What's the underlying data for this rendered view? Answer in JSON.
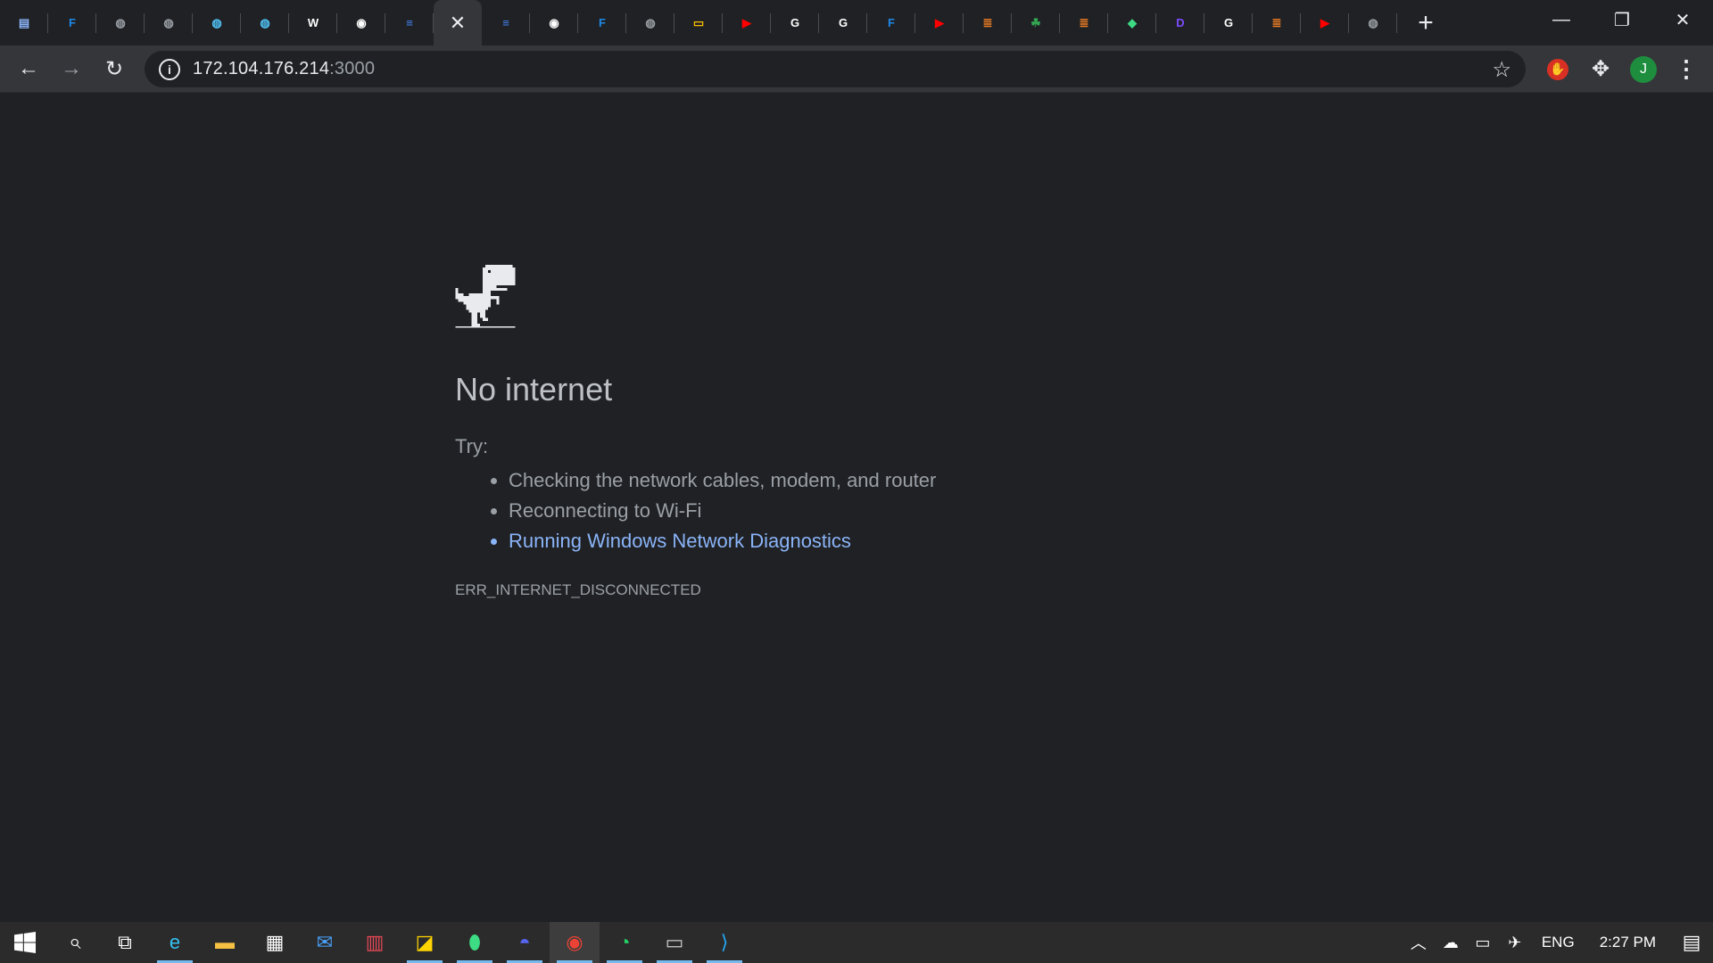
{
  "browser": {
    "tabs": [
      {
        "icon": "docs-file-icon",
        "color": "#8ab4f8",
        "glyph": "▤"
      },
      {
        "icon": "f-brand-icon",
        "color": "#1e88e5",
        "glyph": "F"
      },
      {
        "icon": "globe-icon",
        "color": "#9aa0a6",
        "glyph": "◍"
      },
      {
        "icon": "globe-icon",
        "color": "#9aa0a6",
        "glyph": "◍"
      },
      {
        "icon": "blue-globe-icon",
        "color": "#4fc3f7",
        "glyph": "◍"
      },
      {
        "icon": "blue-globe-icon",
        "color": "#4fc3f7",
        "glyph": "◍"
      },
      {
        "icon": "wikipedia-icon",
        "color": "#ffffff",
        "glyph": "W"
      },
      {
        "icon": "github-icon",
        "color": "#ffffff",
        "glyph": "◉"
      },
      {
        "icon": "google-docs-icon",
        "color": "#4285f4",
        "glyph": "≡"
      },
      {
        "icon": "close-icon",
        "color": "#e8eaed",
        "glyph": "✕",
        "active": true
      },
      {
        "icon": "google-docs-icon",
        "color": "#4285f4",
        "glyph": "≡"
      },
      {
        "icon": "github-icon",
        "color": "#ffffff",
        "glyph": "◉"
      },
      {
        "icon": "f-brand-icon",
        "color": "#1e88e5",
        "glyph": "F"
      },
      {
        "icon": "globe-icon",
        "color": "#9aa0a6",
        "glyph": "◍"
      },
      {
        "icon": "google-slides-icon",
        "color": "#fbbc04",
        "glyph": "▭"
      },
      {
        "icon": "youtube-icon",
        "color": "#ff0000",
        "glyph": "▶"
      },
      {
        "icon": "google-icon",
        "color": "#ffffff",
        "glyph": "G"
      },
      {
        "icon": "google-icon",
        "color": "#ffffff",
        "glyph": "G"
      },
      {
        "icon": "f-brand-icon",
        "color": "#1e88e5",
        "glyph": "F"
      },
      {
        "icon": "youtube-icon",
        "color": "#ff0000",
        "glyph": "▶"
      },
      {
        "icon": "stack-overflow-icon",
        "color": "#f48024",
        "glyph": "≣"
      },
      {
        "icon": "green-leaf-icon",
        "color": "#34a853",
        "glyph": "☘"
      },
      {
        "icon": "stack-overflow-icon",
        "color": "#f48024",
        "glyph": "≣"
      },
      {
        "icon": "android-icon",
        "color": "#3ddc84",
        "glyph": "◆"
      },
      {
        "icon": "purple-d-icon",
        "color": "#7c4dff",
        "glyph": "D"
      },
      {
        "icon": "google-icon",
        "color": "#ffffff",
        "glyph": "G"
      },
      {
        "icon": "stack-overflow-icon",
        "color": "#f48024",
        "glyph": "≣"
      },
      {
        "icon": "youtube-icon",
        "color": "#ff0000",
        "glyph": "▶"
      },
      {
        "icon": "globe-icon",
        "color": "#9aa0a6",
        "glyph": "◍"
      }
    ],
    "new_tab_glyph": "+",
    "window_controls": {
      "minimize": "—",
      "restore": "❐",
      "close": "✕"
    },
    "url_host": "172.104.176.214",
    "url_port": ":3000",
    "profile_initial": "J"
  },
  "error_page": {
    "title": "No internet",
    "try_label": "Try:",
    "suggestions": [
      "Checking the network cables, modem, and router",
      "Reconnecting to Wi-Fi",
      "Running Windows Network Diagnostics"
    ],
    "error_code": "ERR_INTERNET_DISCONNECTED"
  },
  "taskbar": {
    "apps": [
      {
        "name": "edge",
        "color": "#35c1f1",
        "glyph": "e",
        "running": true
      },
      {
        "name": "file-explorer",
        "color": "#f6c142",
        "glyph": "▬",
        "running": false
      },
      {
        "name": "microsoft-store",
        "color": "#ffffff",
        "glyph": "▦",
        "running": false
      },
      {
        "name": "mail",
        "color": "#4aa3ff",
        "glyph": "✉",
        "running": false
      },
      {
        "name": "gift-app",
        "color": "#e74856",
        "glyph": "▥",
        "running": false
      },
      {
        "name": "sticky-notes",
        "color": "#ffd400",
        "glyph": "◪",
        "running": true
      },
      {
        "name": "pin-app",
        "color": "#3ddc84",
        "glyph": "⬮",
        "running": true
      },
      {
        "name": "discord",
        "color": "#5865f2",
        "glyph": "◓",
        "running": true
      },
      {
        "name": "chrome",
        "color": "#ea4335",
        "glyph": "◉",
        "running": true,
        "active": true
      },
      {
        "name": "whatsapp",
        "color": "#25d366",
        "glyph": "◔",
        "running": true
      },
      {
        "name": "terminal",
        "color": "#cccccc",
        "glyph": "▭",
        "running": true
      },
      {
        "name": "vscode",
        "color": "#23a9f2",
        "glyph": "⟩",
        "running": true
      }
    ],
    "language": "ENG",
    "time": "2:27 PM"
  }
}
